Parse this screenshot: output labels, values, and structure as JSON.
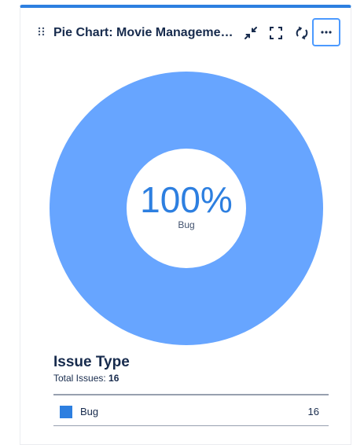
{
  "gadget": {
    "title": "Pie Chart: Movie Management...",
    "accent_color": "#2d7fe0",
    "buttons": {
      "minimize_icon": "minimize-icon",
      "fullscreen_icon": "fullscreen-icon",
      "refresh_icon": "refresh-icon",
      "more_label": "···"
    }
  },
  "chart_data": {
    "type": "pie",
    "style": "donut",
    "categories": [
      "Bug"
    ],
    "values": [
      16
    ],
    "colors": [
      "#67a5ff"
    ],
    "center_text": {
      "percent": "100%",
      "label": "Bug"
    }
  },
  "legend": {
    "title": "Issue Type",
    "total_label": "Total Issues:",
    "total_value": "16",
    "rows": [
      {
        "label": "Bug",
        "count": "16",
        "color": "#2d7fe0"
      }
    ]
  }
}
